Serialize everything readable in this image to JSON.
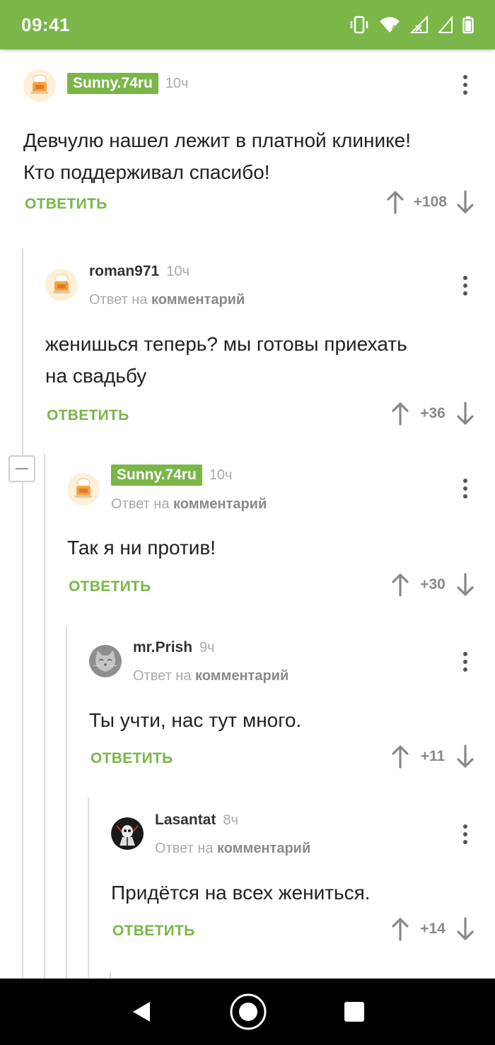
{
  "status_bar": {
    "time": "09:41"
  },
  "comments": [
    {
      "username": "Sunny.74ru",
      "time": "10ч",
      "reply_prefix": "",
      "reply_link": "",
      "text_lines": [
        "Девчулю нашел лежит в платной клинике!",
        "Кто поддерживал спасибо!"
      ],
      "reply_label": "ОТВЕТИТЬ",
      "score": "+108"
    },
    {
      "username": "roman971",
      "time": "10ч",
      "reply_prefix": "Ответ на",
      "reply_link": "комментарий",
      "text_lines": [
        "женишься теперь? мы готовы приехать",
        "на свадьбу"
      ],
      "reply_label": "ОТВЕТИТЬ",
      "score": "+36"
    },
    {
      "username": "Sunny.74ru",
      "time": "10ч",
      "reply_prefix": "Ответ на",
      "reply_link": "комментарий",
      "text_lines": [
        "Так я ни против!"
      ],
      "reply_label": "ОТВЕТИТЬ",
      "score": "+30"
    },
    {
      "username": "mr.Prish",
      "time": "9ч",
      "reply_prefix": "Ответ на",
      "reply_link": "комментарий",
      "text_lines": [
        "Ты учти, нас тут много."
      ],
      "reply_label": "ОТВЕТИТЬ",
      "score": "+11"
    },
    {
      "username": "Lasantat",
      "time": "8ч",
      "reply_prefix": "Ответ на",
      "reply_link": "комментарий",
      "text_lines": [
        "Придётся на всех жениться."
      ],
      "reply_label": "ОТВЕТИТЬ",
      "score": "+14"
    }
  ],
  "colors": {
    "accent": "#7ab648",
    "muted": "#aaaaaa",
    "text": "#222222",
    "nav_bar": "#000000"
  },
  "icons": {
    "menu": "more-vert-icon",
    "upvote": "arrow-up-icon",
    "downvote": "arrow-down-icon",
    "collapse": "minus-icon",
    "nav_back": "triangle-back-icon",
    "nav_home": "circle-home-icon",
    "nav_recents": "square-recents-icon"
  }
}
